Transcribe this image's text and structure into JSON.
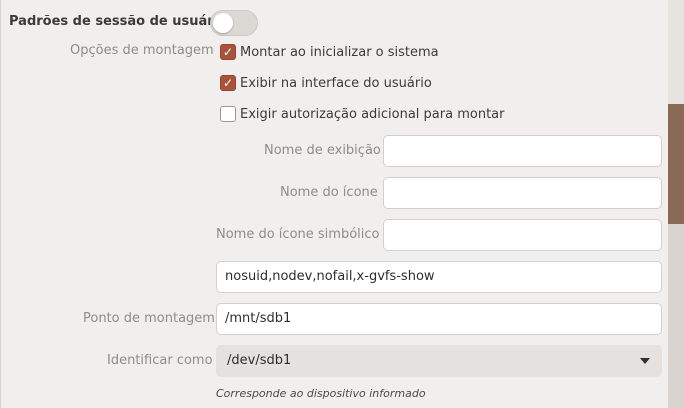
{
  "header": {
    "title": "Padrões de sessão de usuário",
    "toggle_on": false
  },
  "mount_options": {
    "label": "Opções de montagem",
    "checks": [
      {
        "label": "Montar ao inicializar o sistema",
        "checked": true
      },
      {
        "label": "Exibir na interface do usuário",
        "checked": true
      },
      {
        "label": "Exigir autorização adicional para montar",
        "checked": false
      }
    ]
  },
  "fields": {
    "display_name": {
      "label": "Nome de exibição",
      "value": ""
    },
    "icon_name": {
      "label": "Nome do ícone",
      "value": ""
    },
    "symbolic_icon_name": {
      "label": "Nome do ícone simbólico",
      "value": ""
    },
    "options_string": {
      "value": "nosuid,nodev,nofail,x-gvfs-show"
    },
    "mount_point": {
      "label": "Ponto de montagem",
      "value": "/mnt/sdb1"
    },
    "identify_as": {
      "label": "Identificar como",
      "value": "/dev/sdb1"
    }
  },
  "hint": "Corresponde ao dispositivo informado",
  "colors": {
    "accent": "#a9533c",
    "background": "#f1efed"
  }
}
